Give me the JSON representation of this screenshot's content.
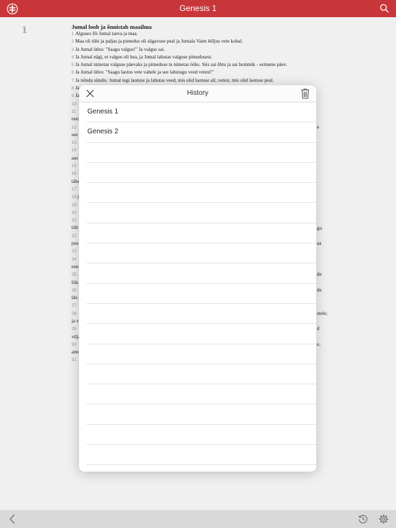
{
  "app": {
    "title": "Genesis 1"
  },
  "chapter": {
    "number": "1",
    "heading": "Jumal loob ja õnnistab maailma",
    "lines": [
      {
        "n": "1",
        "t": "Alguses lõi Jumal taeva ja maa."
      },
      {
        "n": "2",
        "t": "Maa oli tühi ja paljas ja pimedus oli sügavuse peal ja Jumala Vaim hõljus vete kohal."
      },
      {
        "n": "3",
        "t": "Ja Jumal ütles: \"Saagu valgus!\" Ja valgus sai."
      },
      {
        "n": "4",
        "t": "Ja Jumal nägi, et valgus oli hea, ja Jumal lahutas valguse pimedusest."
      },
      {
        "n": "5",
        "t": "Ja Jumal nimetas valguse päevaks ja pimeduse ta nimetas ööks. Siis sai õhtu ja sai hommik - esimene päev."
      },
      {
        "n": "6",
        "t": "Ja Jumal ütles: \"Saagu laotus vete vahele ja see lahutagu veed vetest!\""
      },
      {
        "n": "7",
        "t": "Ja nõnda sündis: Jumal tegi laotuse ja lahutas veed, mis olid laotuse all, vetest, mis olid laotuse peal."
      },
      {
        "n": "8",
        "t": "Ja"
      },
      {
        "n": "9",
        "t": "Ja"
      },
      {
        "n": "10",
        "t": ""
      },
      {
        "n": "11",
        "t": ""
      },
      {
        "n": "",
        "t": "nen"
      },
      {
        "n": "12",
        "t": ""
      },
      {
        "n": "",
        "t": "see"
      },
      {
        "n": "13",
        "t": ""
      },
      {
        "n": "14",
        "t": ""
      },
      {
        "n": "",
        "t": "aas"
      },
      {
        "n": "15",
        "t": ""
      },
      {
        "n": "16",
        "t": ""
      },
      {
        "n": "",
        "t": "tähe"
      },
      {
        "n": "17",
        "t": ""
      },
      {
        "n": "18",
        "t": "j"
      },
      {
        "n": "19",
        "t": ""
      },
      {
        "n": "20",
        "t": ""
      },
      {
        "n": "21",
        "t": ""
      },
      {
        "n": "",
        "t": "tiib"
      },
      {
        "n": "22",
        "t": ""
      },
      {
        "n": "",
        "t": "pea"
      },
      {
        "n": "23",
        "t": ""
      },
      {
        "n": "24",
        "t": ""
      },
      {
        "n": "",
        "t": "nen"
      },
      {
        "n": "25",
        "t": ""
      },
      {
        "n": "",
        "t": "liik"
      },
      {
        "n": "26",
        "t": ""
      },
      {
        "n": "",
        "t": "üle"
      },
      {
        "n": "27",
        "t": ""
      },
      {
        "n": "28",
        "t": ""
      },
      {
        "n": "",
        "t": "ja v"
      },
      {
        "n": "29",
        "t": ""
      },
      {
        "n": "",
        "t": "vilja"
      },
      {
        "n": "30",
        "t": ""
      },
      {
        "n": "",
        "t": "ann"
      },
      {
        "n": "31",
        "t": ""
      }
    ],
    "right_fragments": [
      {
        "line": 12,
        "t": "e"
      },
      {
        "line": 25,
        "t": "gu"
      },
      {
        "line": 27,
        "t": "aa"
      },
      {
        "line": 31,
        "t": "de"
      },
      {
        "line": 33,
        "t": "de"
      },
      {
        "line": 36,
        "t": "stele;"
      },
      {
        "line": 38,
        "t": "d"
      },
      {
        "line": 40,
        "t": "e,"
      }
    ]
  },
  "history": {
    "title": "History",
    "items": [
      {
        "label": "Genesis 1"
      },
      {
        "label": "Genesis 2"
      },
      {
        "label": ""
      },
      {
        "label": ""
      },
      {
        "label": ""
      },
      {
        "label": ""
      },
      {
        "label": ""
      },
      {
        "label": ""
      },
      {
        "label": ""
      },
      {
        "label": ""
      },
      {
        "label": ""
      },
      {
        "label": ""
      },
      {
        "label": ""
      },
      {
        "label": ""
      },
      {
        "label": ""
      },
      {
        "label": ""
      },
      {
        "label": ""
      },
      {
        "label": ""
      }
    ]
  },
  "icons": {
    "logo": "bible-app-logo-icon",
    "search": "search-icon",
    "close": "close-icon",
    "trash": "trash-icon",
    "back": "chevron-left-icon",
    "history": "history-icon",
    "settings": "gear-icon"
  },
  "colors": {
    "accent": "#c8363a",
    "toolbar": "#d9d9d9"
  }
}
